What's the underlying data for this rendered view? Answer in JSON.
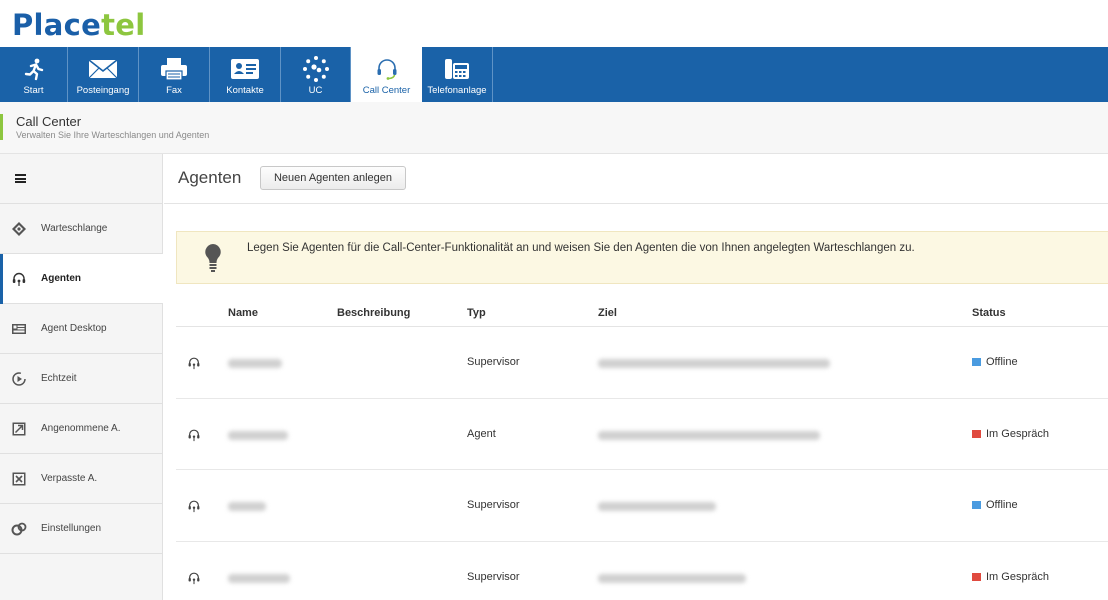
{
  "brand": {
    "logo_part1": "Place",
    "logo_part2": "tel",
    "accent_blue": "#1a62a8",
    "accent_green": "#8dc63f"
  },
  "topnav": {
    "tabs": [
      {
        "label": "Start",
        "icon": "running-person-icon",
        "active": false
      },
      {
        "label": "Posteingang",
        "icon": "envelope-icon",
        "active": false
      },
      {
        "label": "Fax",
        "icon": "fax-icon",
        "active": false
      },
      {
        "label": "Kontakte",
        "icon": "contact-card-icon",
        "active": false
      },
      {
        "label": "UC",
        "icon": "uc-network-icon",
        "active": false
      },
      {
        "label": "Call Center",
        "icon": "headset-icon",
        "active": true
      },
      {
        "label": "Telefonanlage",
        "icon": "desk-phone-icon",
        "active": false
      }
    ]
  },
  "page_header": {
    "title": "Call Center",
    "subtitle": "Verwalten Sie Ihre Warteschlangen und Agenten"
  },
  "sidebar": {
    "menu_icon": "hamburger-icon",
    "items": [
      {
        "label": "Warteschlange",
        "icon": "queue-icon",
        "active": false
      },
      {
        "label": "Agenten",
        "icon": "agent-headset-icon",
        "active": true
      },
      {
        "label": "Agent Desktop",
        "icon": "agent-desktop-icon",
        "active": false
      },
      {
        "label": "Echtzeit",
        "icon": "realtime-icon",
        "active": false
      },
      {
        "label": "Angenommene A.",
        "icon": "accepted-calls-icon",
        "active": false
      },
      {
        "label": "Verpasste A.",
        "icon": "missed-calls-icon",
        "active": false
      },
      {
        "label": "Einstellungen",
        "icon": "settings-icon",
        "active": false
      }
    ]
  },
  "main": {
    "title": "Agenten",
    "new_agent_button": "Neuen Agenten anlegen",
    "info_text": "Legen Sie Agenten für die Call-Center-Funktionalität an und weisen Sie den Agenten die von Ihnen angelegten Warteschlangen zu.",
    "info_icon": "lightbulb-icon"
  },
  "table": {
    "columns": {
      "name": "Name",
      "description": "Beschreibung",
      "type": "Typ",
      "target": "Ziel",
      "status": "Status"
    },
    "rows": [
      {
        "type": "Supervisor",
        "status": "Offline",
        "status_color": "#4a9be0"
      },
      {
        "type": "Agent",
        "status": "Im Gespräch",
        "status_color": "#e04a3f"
      },
      {
        "type": "Supervisor",
        "status": "Offline",
        "status_color": "#4a9be0"
      },
      {
        "type": "Supervisor",
        "status": "Im Gespräch",
        "status_color": "#e04a3f"
      }
    ]
  }
}
